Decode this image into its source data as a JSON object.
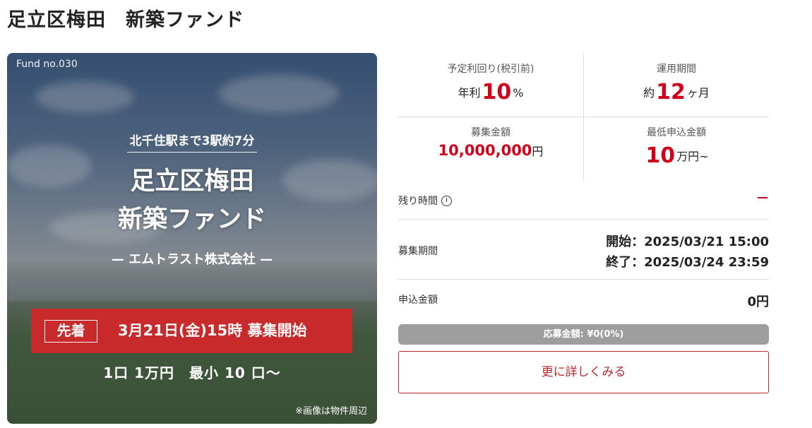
{
  "page": {
    "title": "足立区梅田　新築ファンド"
  },
  "hero": {
    "fund_no": "Fund no.030",
    "station": "北千住駅まで3駅約7分",
    "title_line1": "足立区梅田",
    "title_line2": "新築ファンド",
    "company": "— エムトラスト株式会社 —",
    "banner_tag": "先着",
    "banner_text": "3月21日(金)15時 募集開始",
    "unit": "1口 1万円　最小 10 口〜",
    "note": "※画像は物件周辺"
  },
  "stats": {
    "yield": {
      "label": "予定利回り(税引前)",
      "prefix": "年利",
      "value": "10",
      "suffix": "%"
    },
    "period": {
      "label": "運用期間",
      "prefix": "約",
      "value": "12",
      "suffix": "ヶ月"
    },
    "amount": {
      "label": "募集金額",
      "value": "10,000,000",
      "suffix": "円"
    },
    "minimum": {
      "label": "最低申込金額",
      "value": "10",
      "suffix": "万円~"
    }
  },
  "remaining": {
    "label": "残り時間",
    "value": "ー"
  },
  "recruit_period": {
    "label": "募集期間",
    "start": "開始：2025/03/21 15:00",
    "end": "終了：2025/03/24 23:59"
  },
  "applied": {
    "label": "申込金額",
    "value": "0円"
  },
  "progress": {
    "text": "応募金額: ¥0(0%)",
    "fraction": 0.0
  },
  "detail_button": {
    "label": "更に詳しくみる"
  },
  "colors": {
    "accent": "#d0021b",
    "button_border": "#c0272d",
    "progress_bg": "#9e9e9e",
    "banner": "#d0282b"
  }
}
